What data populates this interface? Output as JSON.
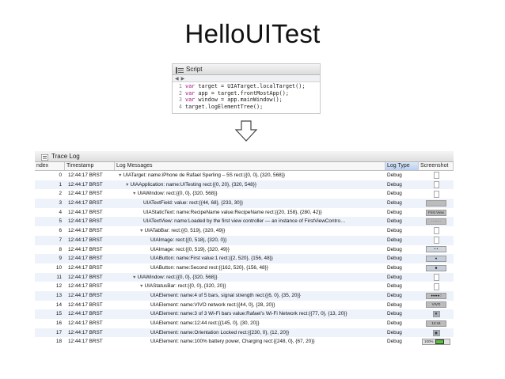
{
  "title": "HelloUITest",
  "script_panel": {
    "title": "Script",
    "lines": [
      {
        "num": "1",
        "keyword": "var",
        "text": " target = UIATarget.localTarget();"
      },
      {
        "num": "2",
        "keyword": "var",
        "text": " app = target.frontMostApp();"
      },
      {
        "num": "3",
        "keyword": "var",
        "text": " window = app.mainWindow();"
      },
      {
        "num": "4",
        "keyword": "",
        "text": "target.logElementTree();"
      }
    ]
  },
  "trace_log": {
    "title": "Trace Log",
    "columns": {
      "index": "ndex",
      "timestamp": "Timestamp",
      "messages": "Log Messages",
      "type": "Log Type",
      "screenshot": "Screenshot"
    },
    "rows": [
      {
        "index": "0",
        "timestamp": "12:44:17 BRST",
        "disc": "▼",
        "message": "UIATarget: name:iPhone de Rafael Sperling – 5S rect:{{0, 0}, {320, 568}}",
        "type": "Debug",
        "shot": "doc",
        "shot_label": ""
      },
      {
        "index": "1",
        "timestamp": "12:44:17 BRST",
        "disc": "▼",
        "message": "UIAApplication: name:UITesting rect:{{0, 20}, {320, 548}}",
        "type": "Debug",
        "shot": "doc",
        "shot_label": ""
      },
      {
        "index": "2",
        "timestamp": "12:44:17 BRST",
        "disc": "▼",
        "message": "UIAWindow: rect:{{0, 0}, {320, 568}}",
        "type": "Debug",
        "shot": "doc",
        "shot_label": ""
      },
      {
        "index": "3",
        "timestamp": "12:44:17 BRST",
        "disc": "",
        "message": "UIATextField: value: rect:{{44, 68}, {233, 30}}",
        "type": "Debug",
        "shot": "plain",
        "shot_label": ""
      },
      {
        "index": "4",
        "timestamp": "12:44:17 BRST",
        "disc": "",
        "message": "UIAStaticText: name:RecipeName value:RecipeName rect:{{20, 158}, {280, 42}}",
        "type": "Debug",
        "shot": "plain",
        "shot_label": "First View"
      },
      {
        "index": "5",
        "timestamp": "12:44:17 BRST",
        "disc": "",
        "message": "UIATextView: name:Loaded by the first view controller — an instance of FirstViewContro…",
        "type": "Debug",
        "shot": "plain",
        "shot_label": "········"
      },
      {
        "index": "6",
        "timestamp": "12:44:17 BRST",
        "disc": "▼",
        "message": "UIATabBar: rect:{{0, 519}, {320, 49}}",
        "type": "Debug",
        "shot": "doc",
        "shot_label": ""
      },
      {
        "index": "7",
        "timestamp": "12:44:17 BRST",
        "disc": "",
        "message": "UIAImage: rect:{{0, 518}, {320, 0}}",
        "type": "Debug",
        "shot": "doc",
        "shot_label": ""
      },
      {
        "index": "8",
        "timestamp": "12:44:17 BRST",
        "disc": "",
        "message": "UIAImage: rect:{{0, 519}, {320, 49}}",
        "type": "Debug",
        "shot": "bars",
        "shot_label": "•    •"
      },
      {
        "index": "9",
        "timestamp": "12:44:17 BRST",
        "disc": "",
        "message": "UIAButton: name:First value:1 rect:{{2, 520}, {156, 48}}",
        "type": "Debug",
        "shot": "btn-blue",
        "shot_label": "●"
      },
      {
        "index": "10",
        "timestamp": "12:44:17 BRST",
        "disc": "",
        "message": "UIAButton: name:Second rect:{{162, 520}, {156, 48}}",
        "type": "Debug",
        "shot": "btn-blue",
        "shot_label": "■"
      },
      {
        "index": "11",
        "timestamp": "12:44:17 BRST",
        "disc": "▼",
        "message": "UIAWindow: rect:{{0, 0}, {320, 568}}",
        "type": "Debug",
        "shot": "doc",
        "shot_label": ""
      },
      {
        "index": "12",
        "timestamp": "12:44:17 BRST",
        "disc": "▼",
        "message": "UIAStatusBar: rect:{{0, 0}, {320, 20}}",
        "type": "Debug",
        "shot": "doc",
        "shot_label": ""
      },
      {
        "index": "13",
        "timestamp": "12:44:17 BRST",
        "disc": "",
        "message": "UIAElement: name:4 of 5 bars, signal strength rect:{{6, 0}, {35, 20}}",
        "type": "Debug",
        "shot": "plain",
        "shot_label": "●●●●○"
      },
      {
        "index": "14",
        "timestamp": "12:44:17 BRST",
        "disc": "",
        "message": "UIAElement: name:VIVO network rect:{{44, 0}, {28, 20}}",
        "type": "Debug",
        "shot": "plain",
        "shot_label": "VIVO"
      },
      {
        "index": "15",
        "timestamp": "12:44:17 BRST",
        "disc": "",
        "message": "UIAElement: name:3 of 3 Wi-Fi bars value:Rafael’s Wi-Fi Network rect:{{77, 0}, {13, 20}}",
        "type": "Debug",
        "shot": "small",
        "shot_label": "▼"
      },
      {
        "index": "16",
        "timestamp": "12:44:17 BRST",
        "disc": "",
        "message": "UIAElement: name:12:44 rect:{{145, 0}, {30, 20}}",
        "type": "Debug",
        "shot": "plain",
        "shot_label": "12:44"
      },
      {
        "index": "17",
        "timestamp": "12:44:17 BRST",
        "disc": "",
        "message": "UIAElement: name:Orientation Locked rect:{{230, 0}, {12, 20}}",
        "type": "Debug",
        "shot": "small",
        "shot_label": "◉"
      },
      {
        "index": "18",
        "timestamp": "12:44:17 BRST",
        "disc": "",
        "message": "UIAElement: name:100% battery power, Charging rect:{{248, 0}, {67, 20}}",
        "type": "Debug",
        "shot": "battery",
        "shot_label": "100%"
      }
    ]
  }
}
